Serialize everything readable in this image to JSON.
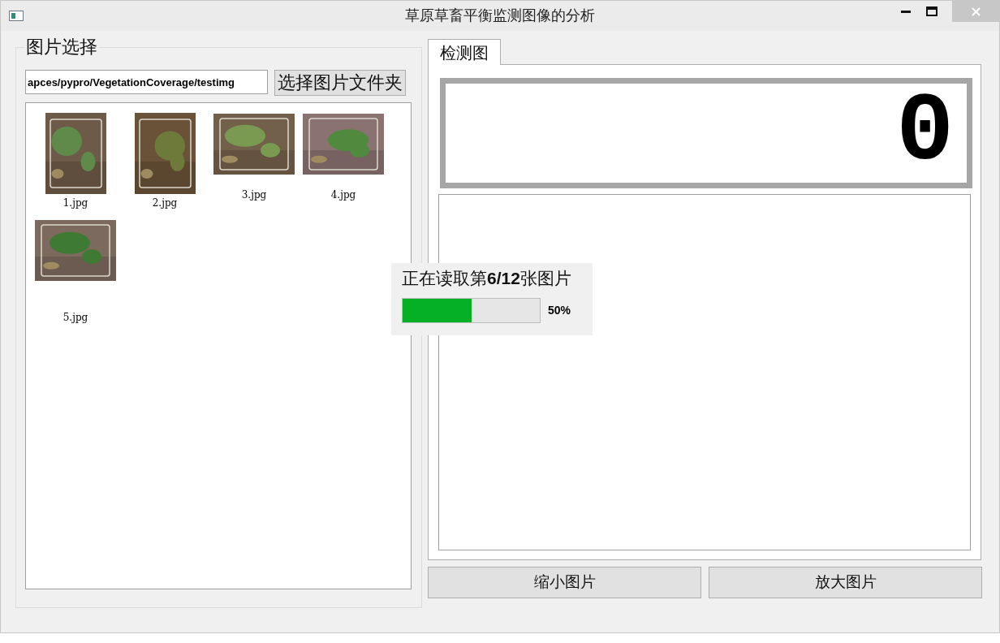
{
  "window": {
    "title": "草原草畜平衡监测图像的分析"
  },
  "image_selection": {
    "title": "图片选择",
    "path_field": {
      "value": "apces/pypro/VegetationCoverage/testimg"
    },
    "choose_button": "选择图片文件夹",
    "thumbnails": [
      {
        "label": "1.jpg",
        "kind": "portrait"
      },
      {
        "label": "2.jpg",
        "kind": "portrait"
      },
      {
        "label": "3.jpg",
        "kind": "landscape"
      },
      {
        "label": "4.jpg",
        "kind": "landscape"
      },
      {
        "label": "5.jpg",
        "kind": "landscape"
      }
    ]
  },
  "tabs": [
    {
      "label": "检测图",
      "selected": true
    }
  ],
  "lcd_display": "0",
  "buttons": [
    "缩小图片",
    "放大图片"
  ],
  "progress_dialog": {
    "message": "正在读取第**6/12**张图片",
    "level": 0.5,
    "reading": "50%"
  }
}
